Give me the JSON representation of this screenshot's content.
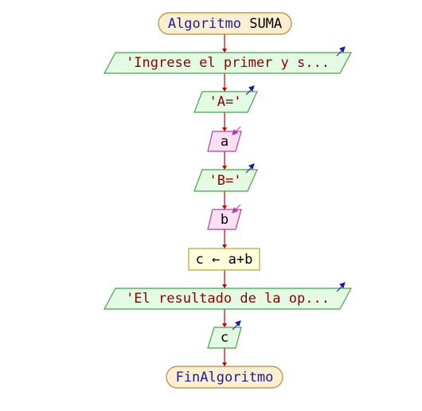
{
  "colors": {
    "connector": "#c00000",
    "terminal_fill": "#fcefcf",
    "terminal_stroke": "#b08a3a",
    "output_fill": "#e3fbe3",
    "output_stroke": "#4aa04a",
    "input_fill": "#fbe0f4",
    "input_stroke": "#b040a0",
    "process_fill": "#ffffdc",
    "process_stroke": "#b0a040",
    "keyword": "#1a1aa8",
    "string": "#8b0000",
    "plain": "#000000",
    "output_arrow": "#1a1aa8",
    "input_arrow": "#b040a0"
  },
  "flowchart": {
    "start": {
      "keyword": "Algoritmo",
      "name": "SUMA"
    },
    "output_1": {
      "text": "'Ingrese el primer y s..."
    },
    "output_2": {
      "text": "'A='"
    },
    "input_1": {
      "text": "a"
    },
    "output_3": {
      "text": "'B='"
    },
    "input_2": {
      "text": "b"
    },
    "process_1": {
      "text": "c ← a+b"
    },
    "output_4": {
      "text": "'El resultado de la op..."
    },
    "output_5": {
      "text": "c"
    },
    "end": {
      "keyword": "FinAlgoritmo"
    }
  }
}
